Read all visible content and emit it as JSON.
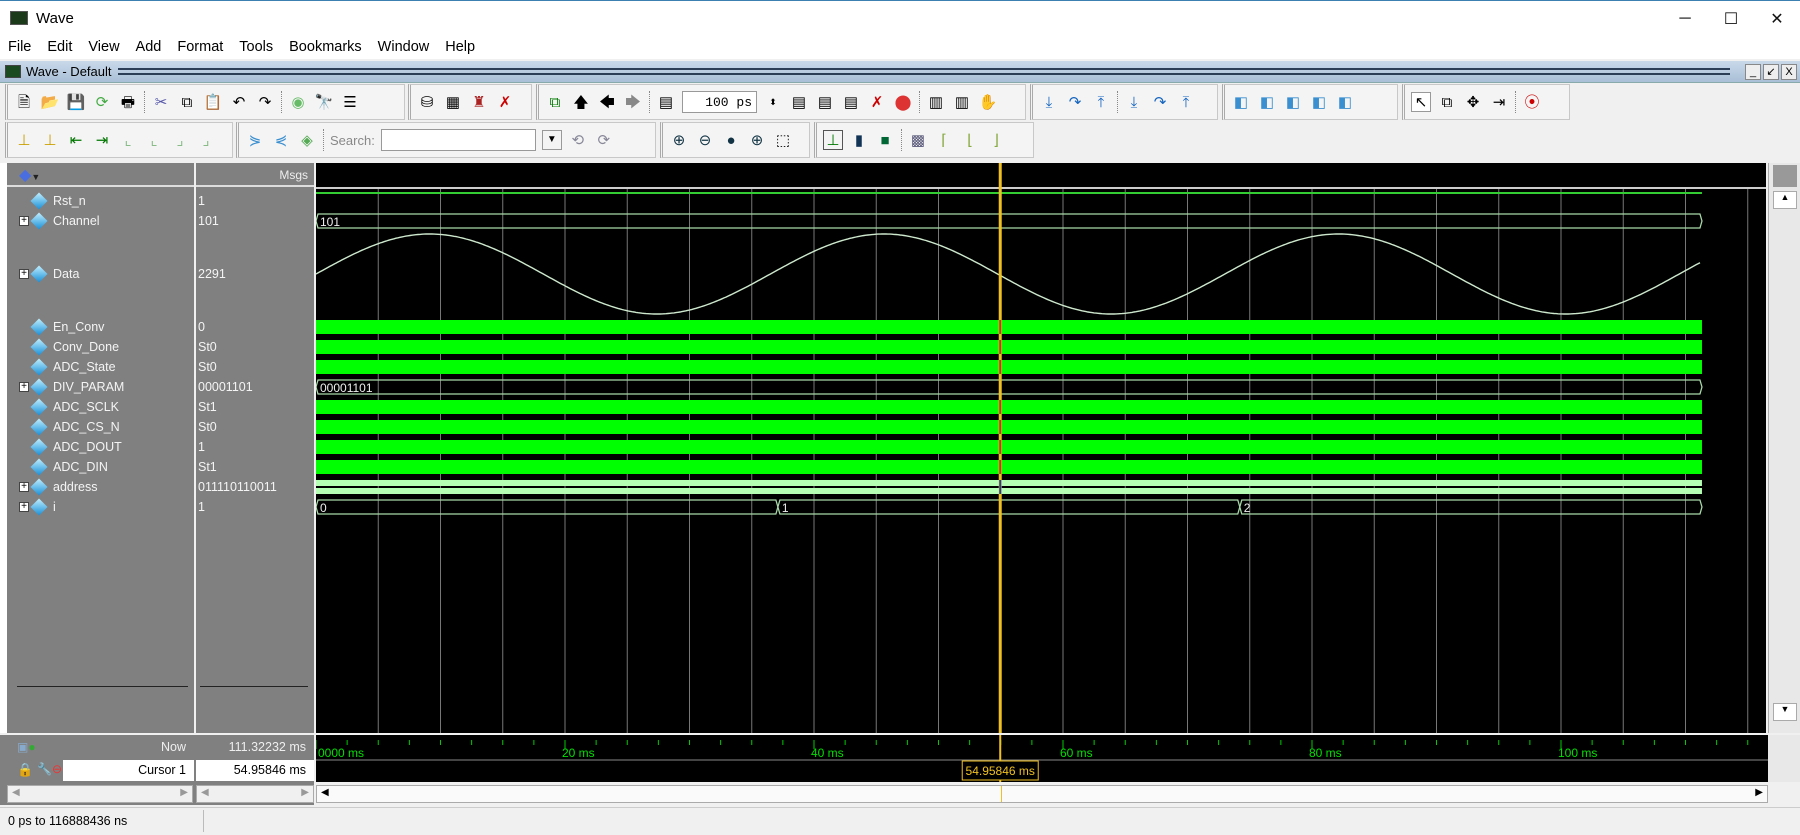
{
  "window": {
    "title": "Wave",
    "minimize": "─",
    "maximize": "☐",
    "close": "✕"
  },
  "menu": [
    "File",
    "Edit",
    "View",
    "Add",
    "Format",
    "Tools",
    "Bookmarks",
    "Window",
    "Help"
  ],
  "subwindow": {
    "title": "Wave - Default"
  },
  "toolbar": {
    "time_step": "100 ps",
    "search_label": "Search:",
    "search_value": ""
  },
  "panes": {
    "msgs_header": "Msgs"
  },
  "signals": [
    {
      "name": "Rst_n",
      "value": "1",
      "kind": "bit-high",
      "expandable": false
    },
    {
      "name": "Channel",
      "value": "101",
      "kind": "bus",
      "expandable": true,
      "segments": [
        {
          "start_ms": 0,
          "label": "101"
        }
      ]
    },
    {
      "name": "Data",
      "value": "2291",
      "kind": "analog",
      "expandable": true
    },
    {
      "name": "En_Conv",
      "value": "0",
      "kind": "toggle",
      "expandable": false
    },
    {
      "name": "Conv_Done",
      "value": "St0",
      "kind": "toggle",
      "expandable": false
    },
    {
      "name": "ADC_State",
      "value": "St0",
      "kind": "toggle",
      "expandable": false
    },
    {
      "name": "DIV_PARAM",
      "value": "00001101",
      "kind": "bus",
      "expandable": true,
      "segments": [
        {
          "start_ms": 0,
          "label": "00001101"
        }
      ]
    },
    {
      "name": "ADC_SCLK",
      "value": "St1",
      "kind": "toggle",
      "expandable": false
    },
    {
      "name": "ADC_CS_N",
      "value": "St0",
      "kind": "toggle",
      "expandable": false
    },
    {
      "name": "ADC_DOUT",
      "value": "1",
      "kind": "toggle",
      "expandable": false
    },
    {
      "name": "ADC_DIN",
      "value": "St1",
      "kind": "toggle",
      "expandable": false
    },
    {
      "name": "address",
      "value": "011110110011",
      "kind": "bus-dense",
      "expandable": true
    },
    {
      "name": "i",
      "value": "1",
      "kind": "bus",
      "expandable": true,
      "segments": [
        {
          "start_ms": 0,
          "label": "0"
        },
        {
          "start_ms": 37.1,
          "label": "1"
        },
        {
          "start_ms": 74.2,
          "label": "2"
        }
      ]
    }
  ],
  "time": {
    "now_label": "Now",
    "now_value": "111.32232 ms",
    "now_ms": 111.32232,
    "cursor_label": "Cursor 1",
    "cursor_value": "54.95846 ms",
    "cursor_ms": 54.95846,
    "tick_labels": [
      {
        "ms": 0,
        "text": "0000 ms"
      },
      {
        "ms": 20,
        "text": "20 ms"
      },
      {
        "ms": 40,
        "text": "40 ms"
      },
      {
        "ms": 60,
        "text": "60 ms"
      },
      {
        "ms": 80,
        "text": "80 ms"
      },
      {
        "ms": 100,
        "text": "100 ms"
      }
    ],
    "grid_step_ms": 5
  },
  "status": {
    "range": "0 ps to 116888436 ns"
  },
  "colors": {
    "toggle": "#00ff00",
    "bus": "#a8d8a8",
    "dense_bus": "#b4ffb4",
    "cursor": "#f0c020",
    "tick_label": "#00e000"
  }
}
